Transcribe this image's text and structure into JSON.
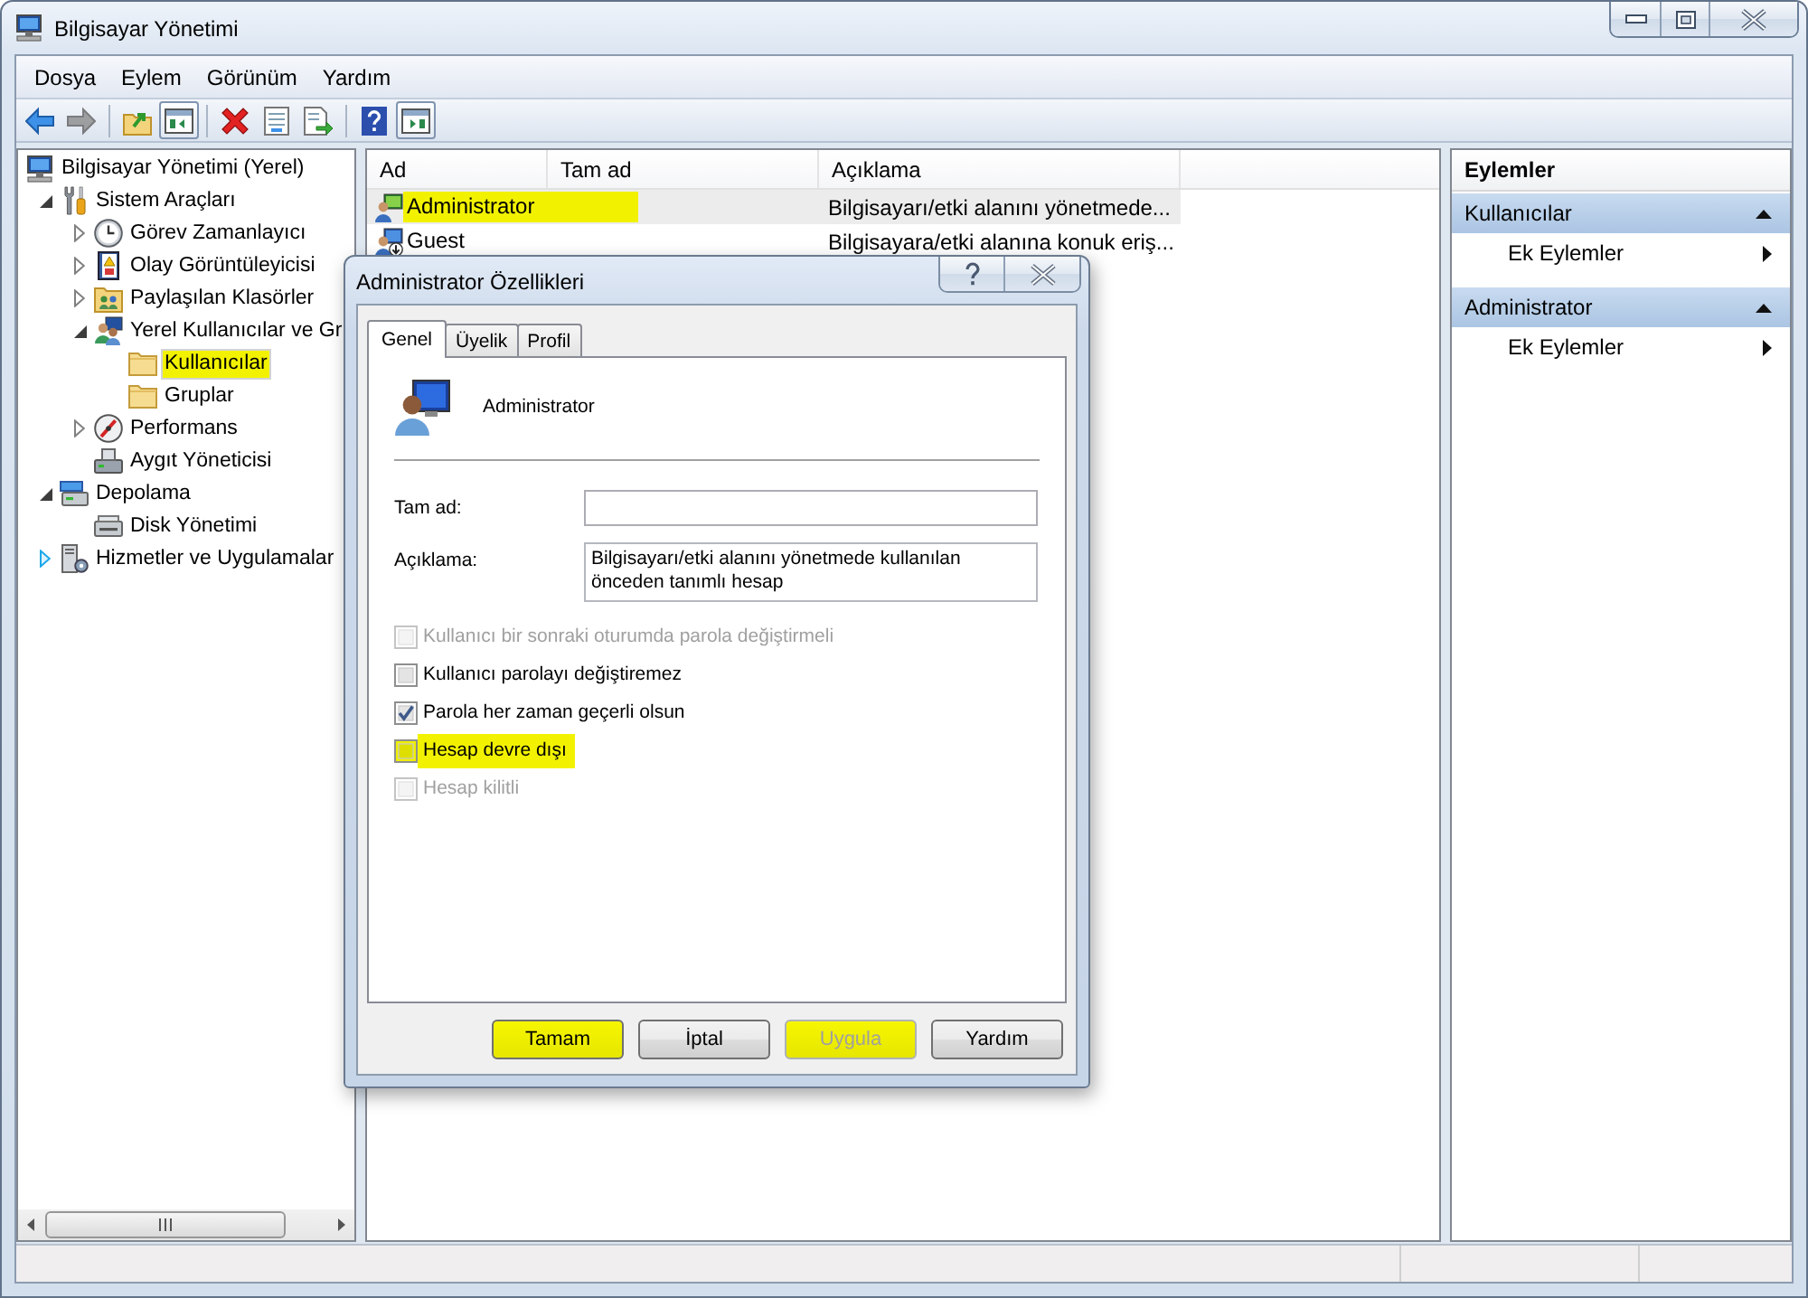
{
  "window": {
    "title": "Bilgisayar Yönetimi"
  },
  "menu": [
    {
      "label": "Dosya"
    },
    {
      "label": "Eylem"
    },
    {
      "label": "Görünüm"
    },
    {
      "label": "Yardım"
    }
  ],
  "toolbar": {
    "groups": [
      {
        "buttons": [
          {
            "pressed": false,
            "disabled": false
          },
          {
            "pressed": false,
            "disabled": true
          }
        ]
      },
      {
        "buttons": [
          {
            "pressed": false,
            "disabled": false
          },
          {
            "pressed": true,
            "disabled": false
          }
        ]
      },
      {
        "buttons": [
          {
            "pressed": false,
            "disabled": false
          },
          {
            "pressed": false,
            "disabled": false
          },
          {
            "pressed": false,
            "disabled": false
          }
        ]
      },
      {
        "buttons": [
          {
            "pressed": false,
            "disabled": false
          },
          {
            "pressed": true,
            "disabled": false
          }
        ]
      }
    ]
  },
  "tree": {
    "items": [
      {
        "label": "Bilgisayar Yönetimi (Yerel)",
        "kind": "computer",
        "selected": false,
        "highlighted": false,
        "children": [
          {
            "label": "Sistem Araçları",
            "kind": "tools",
            "expanded": true,
            "selected": false,
            "highlighted": false,
            "children": [
              {
                "label": "Görev Zamanlayıcı",
                "kind": "scheduler",
                "expanded": false,
                "selected": false,
                "highlighted": false
              },
              {
                "label": "Olay Görüntüleyicisi",
                "kind": "events",
                "expanded": false,
                "selected": false,
                "highlighted": false
              },
              {
                "label": "Paylaşılan Klasörler",
                "kind": "shares",
                "expanded": false,
                "selected": false,
                "highlighted": false
              },
              {
                "label": "Yerel Kullanıcılar ve Gr",
                "kind": "local-users",
                "expanded": true,
                "selected": false,
                "highlighted": false,
                "children": [
                  {
                    "label": "Kullanıcılar",
                    "kind": "folder",
                    "selected": true,
                    "highlighted": true
                  },
                  {
                    "label": "Gruplar",
                    "kind": "folder",
                    "selected": false,
                    "highlighted": false
                  }
                ]
              },
              {
                "label": "Performans",
                "kind": "performance",
                "expanded": false,
                "selected": false,
                "highlighted": false
              },
              {
                "label": "Aygıt Yöneticisi",
                "kind": "devices",
                "selected": false,
                "highlighted": false
              }
            ]
          },
          {
            "label": "Depolama",
            "kind": "storage",
            "expanded": true,
            "selected": false,
            "highlighted": false,
            "children": [
              {
                "label": "Disk Yönetimi",
                "kind": "disk",
                "selected": false,
                "highlighted": false
              }
            ]
          },
          {
            "label": "Hizmetler ve Uygulamalar",
            "kind": "services",
            "expanded": false,
            "hovered": true,
            "selected": false,
            "highlighted": false
          }
        ]
      }
    ]
  },
  "list": {
    "columns": [
      {
        "label": "Ad"
      },
      {
        "label": "Tam ad"
      },
      {
        "label": "Açıklama"
      }
    ],
    "rows": [
      {
        "name": "Administrator",
        "description": "Bilgisayarı/etki alanını yönetmede...",
        "disabled": false,
        "selected": true,
        "highlighted": true
      },
      {
        "name": "Guest",
        "description": "Bilgisayara/etki alanına konuk eriş...",
        "disabled": true,
        "selected": false,
        "highlighted": false
      }
    ]
  },
  "actions": {
    "title": "Eylemler",
    "sections": [
      {
        "title": "Kullanıcılar",
        "expanded": true,
        "items": [
          {
            "label": "Ek Eylemler",
            "submenu": true
          }
        ]
      },
      {
        "title": "Administrator",
        "expanded": true,
        "items": [
          {
            "label": "Ek Eylemler",
            "submenu": true
          }
        ]
      }
    ]
  },
  "dialog": {
    "title": "Administrator Özellikleri",
    "tabs": [
      {
        "label": "Genel",
        "selected": true
      },
      {
        "label": "Üyelik",
        "selected": false
      },
      {
        "label": "Profil",
        "selected": false
      }
    ],
    "user_name": "Administrator",
    "fields": [
      {
        "label": "Tam ad:",
        "kind": "single"
      },
      {
        "label": "Açıklama:",
        "kind": "multiline",
        "value": "Bilgisayarı/etki alanını yönetmede kullanılan önceden tanımlı hesap"
      }
    ],
    "checkboxes": [
      {
        "label": "Kullanıcı bir sonraki oturumda parola değiştirmeli",
        "checked": false,
        "disabled": true,
        "highlighted": false
      },
      {
        "label": "Kullanıcı parolayı değiştiremez",
        "checked": false,
        "disabled": false,
        "highlighted": false
      },
      {
        "label": "Parola her zaman geçerli olsun",
        "checked": true,
        "disabled": false,
        "highlighted": false
      },
      {
        "label": "Hesap devre dışı",
        "checked": false,
        "disabled": false,
        "highlighted": true
      },
      {
        "label": "Hesap kilitli",
        "checked": false,
        "disabled": true,
        "highlighted": false
      }
    ],
    "buttons": [
      {
        "label": "Tamam",
        "disabled": false,
        "highlighted": true
      },
      {
        "label": "İptal",
        "disabled": false,
        "highlighted": false
      },
      {
        "label": "Uygula",
        "disabled": true,
        "highlighted": true
      },
      {
        "label": "Yardım",
        "disabled": false,
        "highlighted": false
      }
    ]
  }
}
